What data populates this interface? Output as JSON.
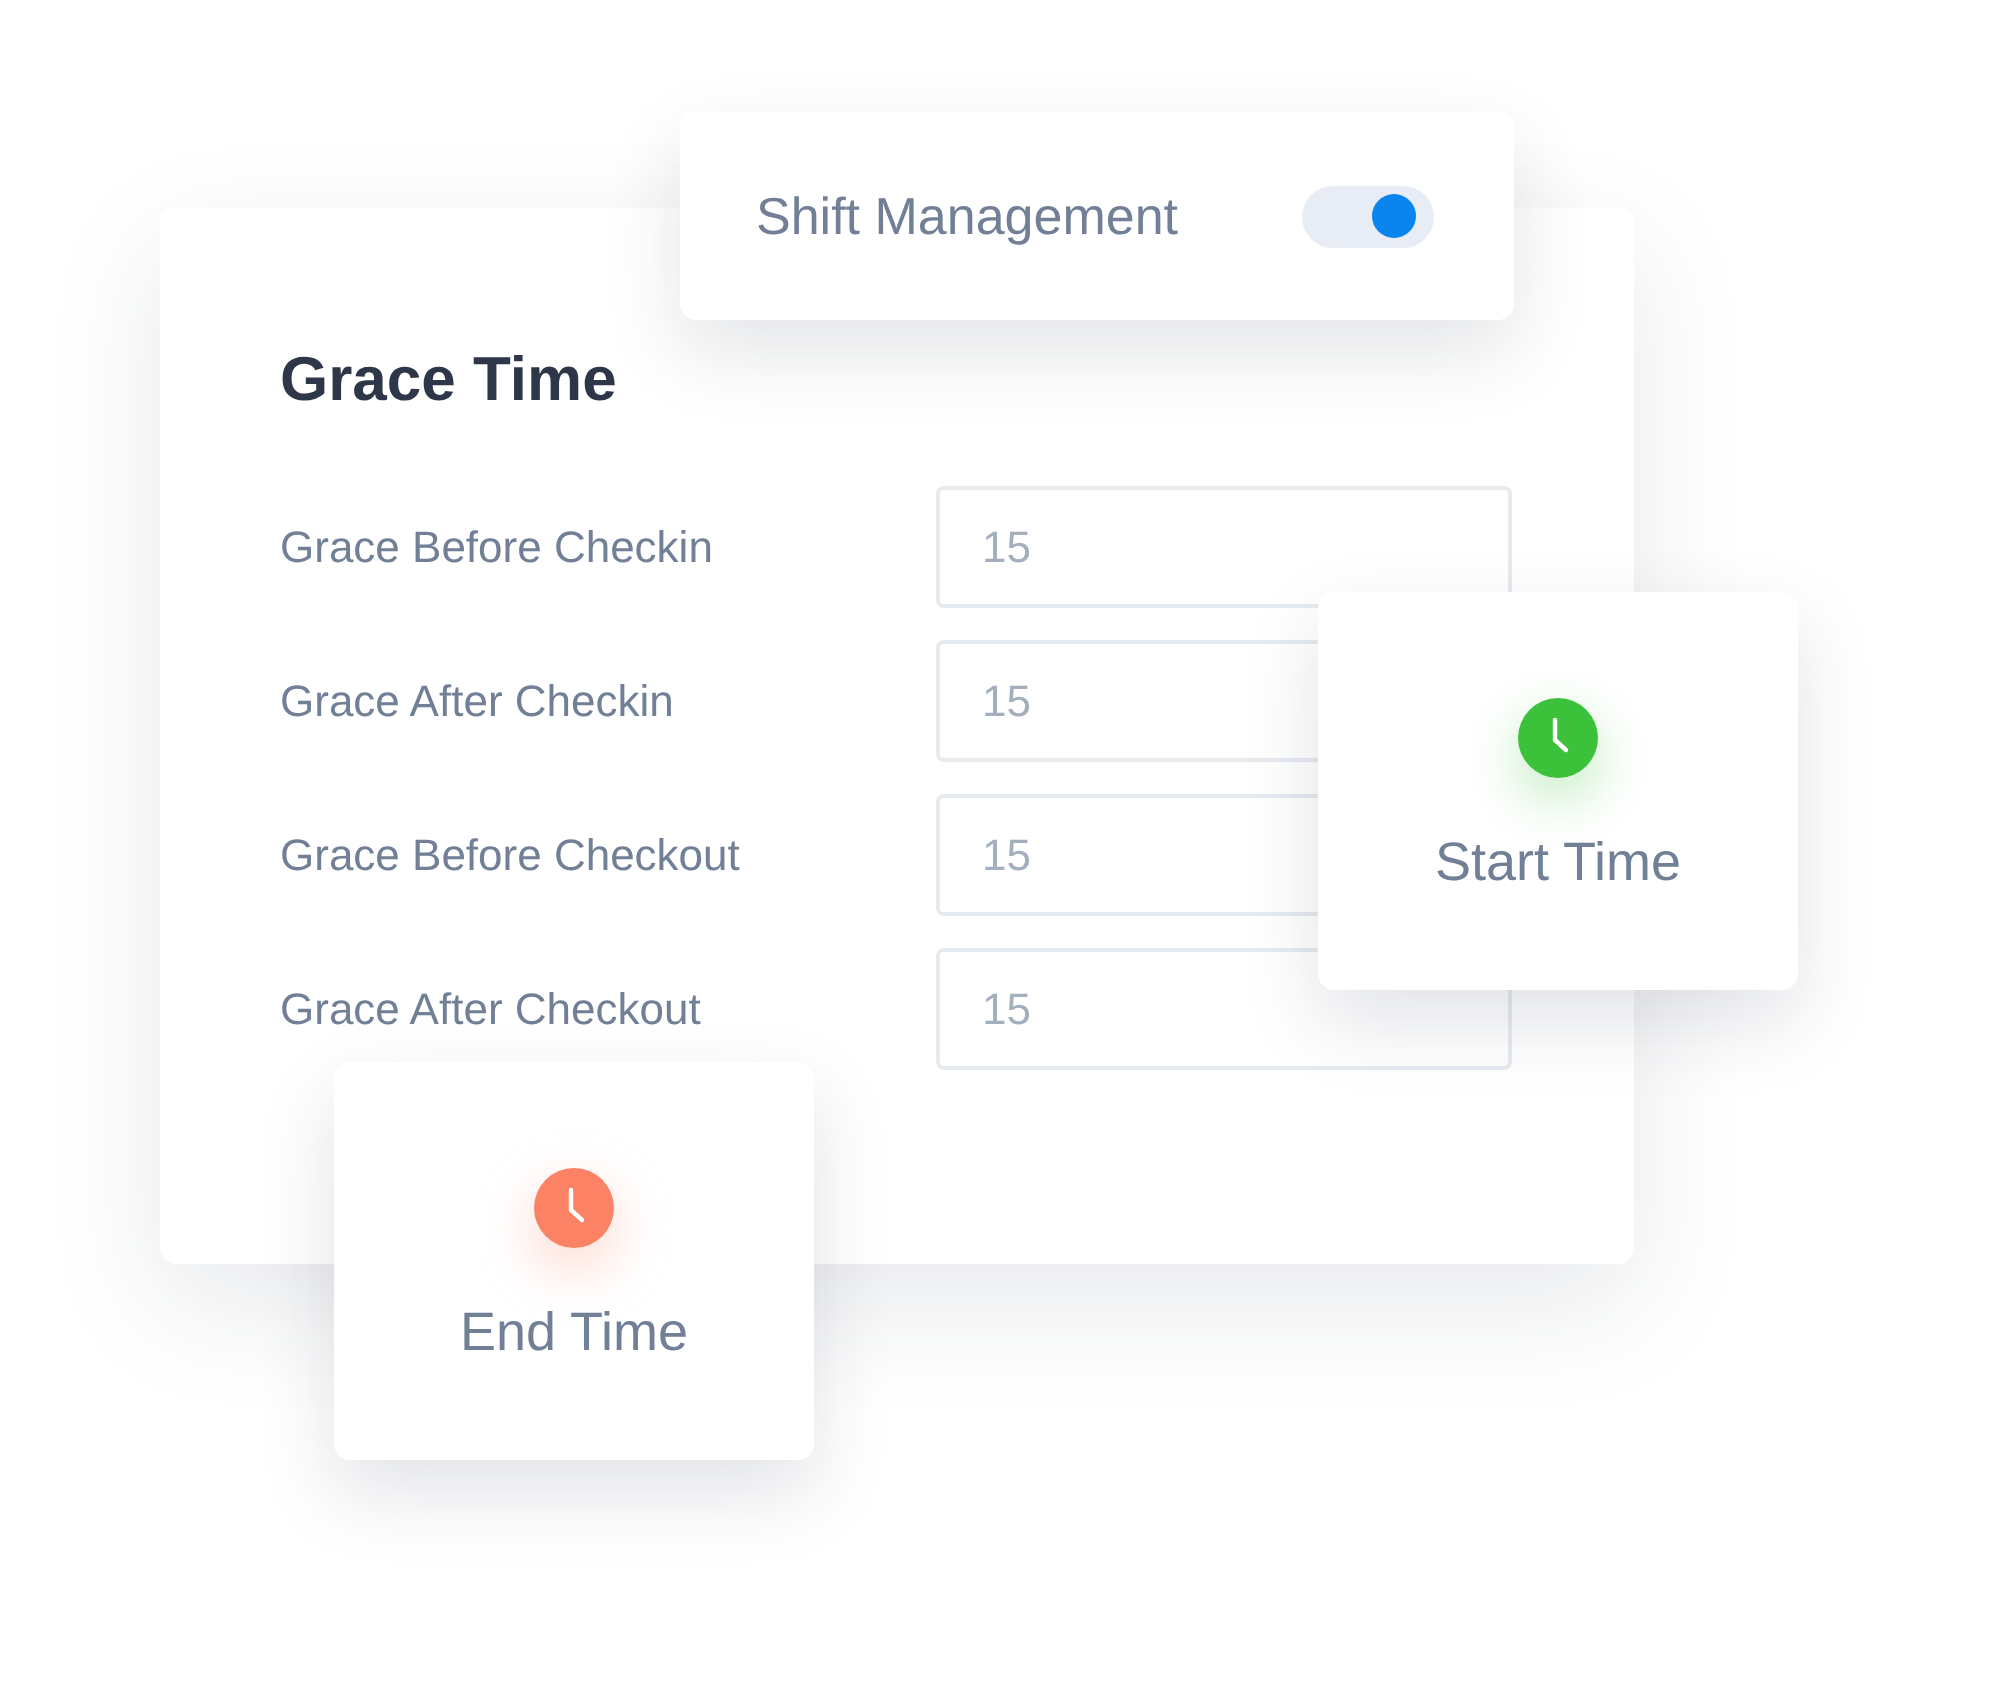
{
  "shift_management": {
    "label": "Shift Management",
    "on": true
  },
  "grace_time": {
    "title": "Grace Time",
    "fields": [
      {
        "label": "Grace Before Checkin",
        "placeholder": "15"
      },
      {
        "label": "Grace After Checkin",
        "placeholder": "15"
      },
      {
        "label": "Grace Before Checkout",
        "placeholder": "15"
      },
      {
        "label": "Grace After Checkout",
        "placeholder": "15"
      }
    ]
  },
  "time_cards": [
    {
      "kind": "start",
      "label": "Start Time",
      "color": "#3cc13b"
    },
    {
      "kind": "end",
      "label": "End Time",
      "color": "#fb8264"
    }
  ]
}
